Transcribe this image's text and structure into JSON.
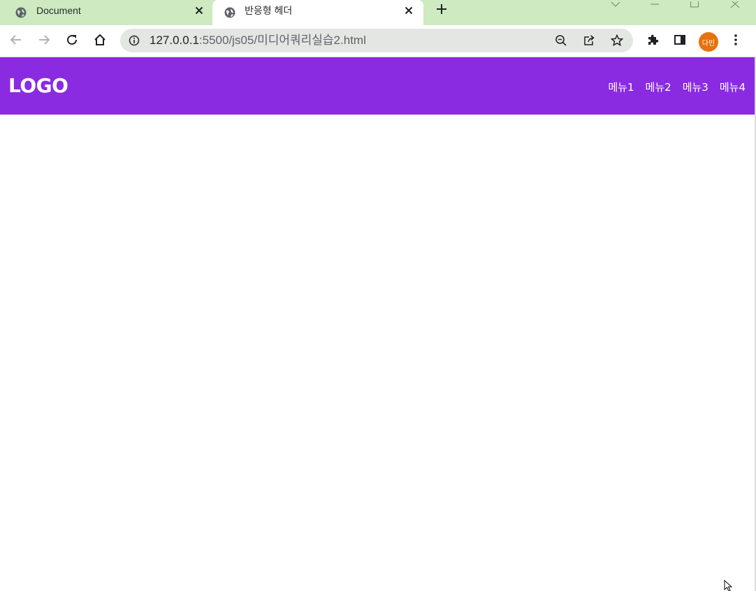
{
  "browser": {
    "tabs": [
      {
        "title": "Document",
        "active": false
      },
      {
        "title": "반응형 헤더",
        "active": true
      }
    ],
    "address": {
      "host": "127.0.0.1",
      "path": ":5500/js05/미디어쿼리실습2.html"
    },
    "profile_initials": "다빈",
    "icons": [
      "globe-icon",
      "close-icon",
      "plus-icon",
      "back-icon",
      "forward-icon",
      "reload-icon",
      "home-icon",
      "info-icon",
      "zoom-out-icon",
      "share-icon",
      "star-icon",
      "extensions-icon",
      "side-panel-icon",
      "more-icon"
    ]
  },
  "page": {
    "logo": "LOGO",
    "menu": [
      "메뉴1",
      "메뉴2",
      "메뉴3",
      "메뉴4"
    ]
  },
  "colors": {
    "tabstrip": "#cdeac0",
    "header_bg": "#8a2be2",
    "header_text": "#ffffff",
    "avatar": "#e8710a"
  }
}
